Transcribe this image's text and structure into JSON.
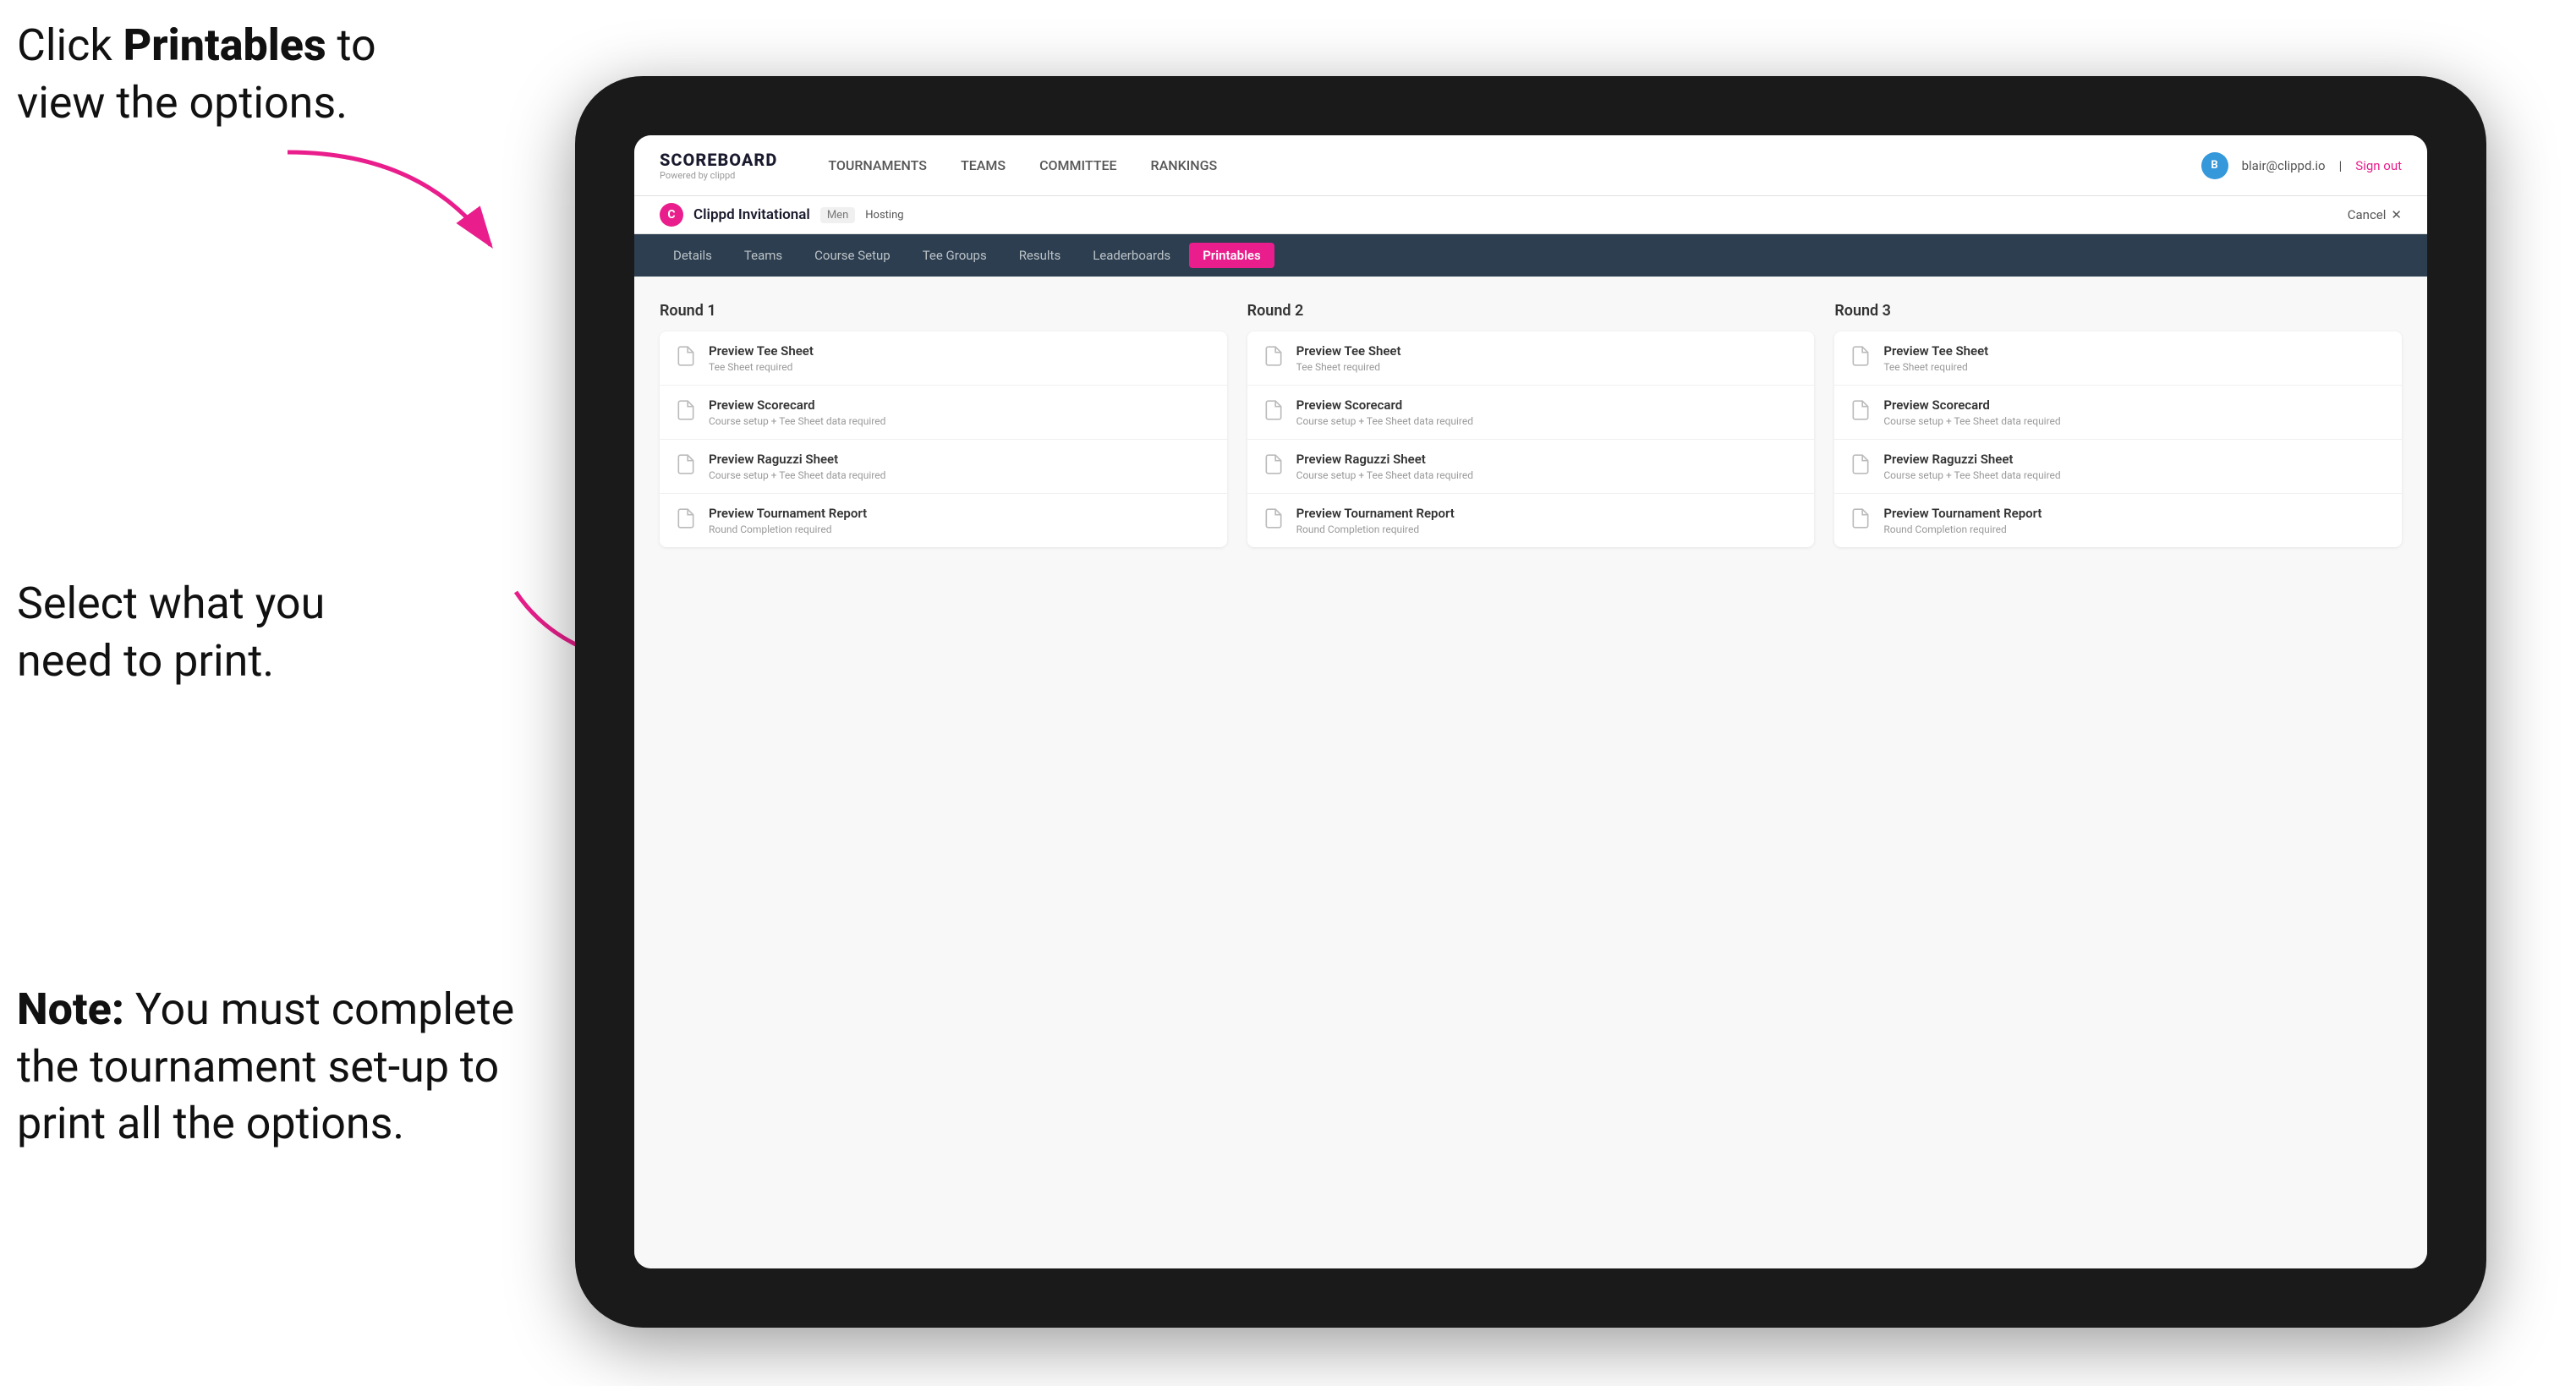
{
  "instructions": {
    "top": {
      "part1": "Click ",
      "bold": "Printables",
      "part2": " to",
      "line2": "view the options."
    },
    "middle": {
      "line1": "Select what you",
      "line2": "need to print."
    },
    "bottom": {
      "bold": "Note:",
      "text": " You must complete the tournament set-up to print all the options."
    }
  },
  "nav": {
    "logo_title": "SCOREBOARD",
    "logo_subtitle": "Powered by clippd",
    "items": [
      {
        "label": "TOURNAMENTS",
        "active": false
      },
      {
        "label": "TEAMS",
        "active": false
      },
      {
        "label": "COMMITTEE",
        "active": false
      },
      {
        "label": "RANKINGS",
        "active": false
      }
    ],
    "user_email": "blair@clippd.io",
    "sign_out": "Sign out",
    "user_initial": "B"
  },
  "tournament_bar": {
    "logo_letter": "C",
    "name": "Clippd Invitational",
    "badge": "Men",
    "hosting": "Hosting",
    "cancel": "Cancel"
  },
  "sub_nav": {
    "items": [
      {
        "label": "Details",
        "active": false
      },
      {
        "label": "Teams",
        "active": false
      },
      {
        "label": "Course Setup",
        "active": false
      },
      {
        "label": "Tee Groups",
        "active": false
      },
      {
        "label": "Results",
        "active": false
      },
      {
        "label": "Leaderboards",
        "active": false
      },
      {
        "label": "Printables",
        "active": true
      }
    ]
  },
  "rounds": [
    {
      "title": "Round 1",
      "cards": [
        {
          "title": "Preview Tee Sheet",
          "subtitle": "Tee Sheet required"
        },
        {
          "title": "Preview Scorecard",
          "subtitle": "Course setup + Tee Sheet data required"
        },
        {
          "title": "Preview Raguzzi Sheet",
          "subtitle": "Course setup + Tee Sheet data required"
        },
        {
          "title": "Preview Tournament Report",
          "subtitle": "Round Completion required"
        }
      ]
    },
    {
      "title": "Round 2",
      "cards": [
        {
          "title": "Preview Tee Sheet",
          "subtitle": "Tee Sheet required"
        },
        {
          "title": "Preview Scorecard",
          "subtitle": "Course setup + Tee Sheet data required"
        },
        {
          "title": "Preview Raguzzi Sheet",
          "subtitle": "Course setup + Tee Sheet data required"
        },
        {
          "title": "Preview Tournament Report",
          "subtitle": "Round Completion required"
        }
      ]
    },
    {
      "title": "Round 3",
      "cards": [
        {
          "title": "Preview Tee Sheet",
          "subtitle": "Tee Sheet required"
        },
        {
          "title": "Preview Scorecard",
          "subtitle": "Course setup + Tee Sheet data required"
        },
        {
          "title": "Preview Raguzzi Sheet",
          "subtitle": "Course setup + Tee Sheet data required"
        },
        {
          "title": "Preview Tournament Report",
          "subtitle": "Round Completion required"
        }
      ]
    }
  ]
}
